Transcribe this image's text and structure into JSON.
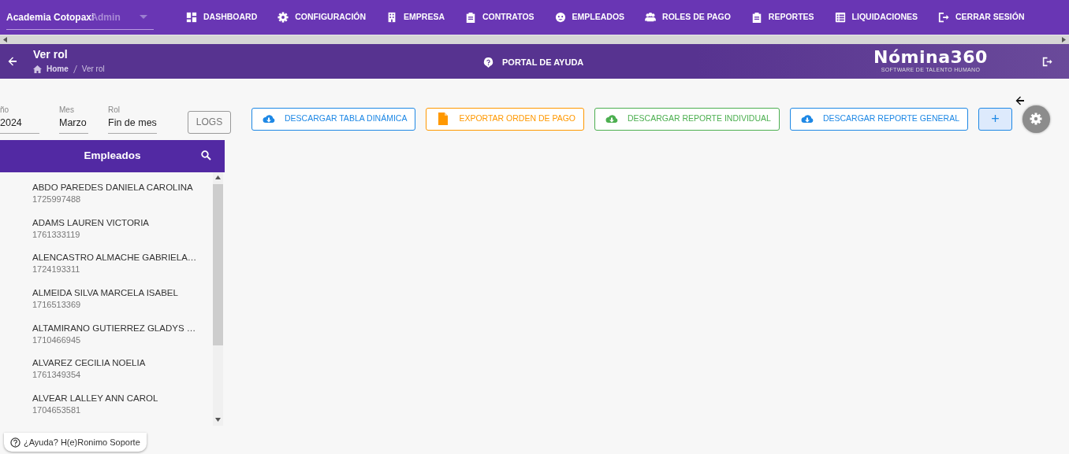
{
  "top_nav": {
    "company": "Academia Cotopaxi",
    "role": "Admin",
    "items": [
      {
        "label": "DASHBOARD"
      },
      {
        "label": "CONFIGURACIÓN"
      },
      {
        "label": "EMPRESA"
      },
      {
        "label": "CONTRATOS"
      },
      {
        "label": "EMPLEADOS"
      },
      {
        "label": "ROLES DE PAGO"
      },
      {
        "label": "REPORTES"
      },
      {
        "label": "LIQUIDACIONES"
      },
      {
        "label": "CERRAR SESIÓN"
      }
    ]
  },
  "header": {
    "title": "Ver rol",
    "breadcrumb": [
      "Home",
      "Ver rol"
    ],
    "help": "PORTAL DE AYUDA",
    "logo": "Nómina360",
    "logo_tagline": "SOFTWARE DE TALENTO HUMANO"
  },
  "filters": [
    {
      "label": "ño",
      "value": "2024"
    },
    {
      "label": "Mes",
      "value": "Marzo"
    },
    {
      "label": "Rol",
      "value": "Fin de mes"
    }
  ],
  "logs_button": "LOGS",
  "actions": [
    {
      "label": "DESCARGAR TABLA DINÁMICA",
      "color": "#1e88e5"
    },
    {
      "label": "EXPORTAR ORDEN DE PAGO",
      "color": "#ff9800"
    },
    {
      "label": "DESCARGAR REPORTE INDIVIDUAL",
      "color": "#4caf50"
    },
    {
      "label": "DESCARGAR REPORTE GENERAL",
      "color": "#1e88e5"
    }
  ],
  "add_button": "+",
  "employees": {
    "title": "Empleados",
    "items": [
      {
        "name": "ABDO PAREDES DANIELA CAROLINA",
        "id": "1725997488"
      },
      {
        "name": "ADAMS LAUREN VICTORIA",
        "id": "1761333119"
      },
      {
        "name": "ALENCASTRO ALMACHE GABRIELA…",
        "id": "1724193311"
      },
      {
        "name": "ALMEIDA SILVA MARCELA ISABEL",
        "id": "1716513369"
      },
      {
        "name": "ALTAMIRANO GUTIERREZ GLADYS …",
        "id": "1710466945"
      },
      {
        "name": "ALVAREZ CECILIA NOELIA",
        "id": "1761349354"
      },
      {
        "name": "ALVEAR LALLEY ANN CAROL",
        "id": "1704653581"
      }
    ]
  },
  "help_chip": "¿Ayuda? H(e)Ronimo Soporte"
}
